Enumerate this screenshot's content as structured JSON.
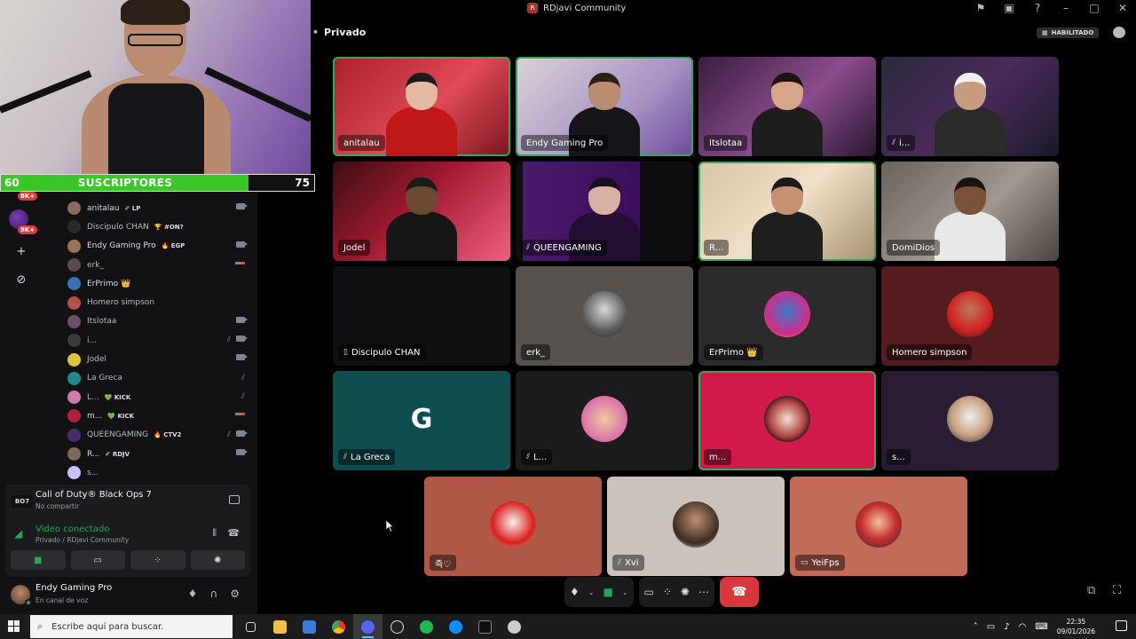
{
  "window": {
    "title": "RDjavi Community",
    "server_icon_text": "R"
  },
  "channel": {
    "name": "Privado",
    "habilitado_label": "HABILITADO"
  },
  "overlay": {
    "sub_goal": {
      "from": "60",
      "label": "SUSCRIPTORES",
      "to": "75",
      "progress": 0.79
    }
  },
  "guild_rail": {
    "badge_top": "8K+",
    "badge_bottom": "9K+"
  },
  "members": [
    {
      "name": "anitalau",
      "tag": "✐ LP",
      "indicator": "camera",
      "avatar": "#8a6a5a",
      "bright": true
    },
    {
      "name": "Discipulo CHAN",
      "tag": "🏆 #ON?",
      "indicator": "",
      "avatar": "#2a2a2a",
      "bright": false
    },
    {
      "name": "Endy Gaming Pro",
      "tag": "🔥 EGP",
      "indicator": "camera",
      "avatar": "#9b7259",
      "bright": true
    },
    {
      "name": "erk_",
      "tag": "",
      "indicator": "live",
      "avatar": "#5a4a4a",
      "bright": false
    },
    {
      "name": "ErPrimo 👑",
      "tag": "",
      "indicator": "",
      "avatar": "#3c6fb5",
      "bright": true
    },
    {
      "name": "Homero simpson",
      "tag": "",
      "indicator": "",
      "avatar": "#b4504a",
      "bright": false
    },
    {
      "name": "Itslotaa",
      "tag": "",
      "indicator": "camera",
      "avatar": "#6d4e66",
      "bright": false
    },
    {
      "name": "i...",
      "tag": "",
      "indicator": "mute-camera",
      "avatar": "#3b3b3b",
      "bright": false
    },
    {
      "name": "Jodel",
      "tag": "",
      "indicator": "camera",
      "avatar": "#e0c33a",
      "bright": false
    },
    {
      "name": "La Greca",
      "tag": "",
      "indicator": "mute",
      "avatar": "#1e8c8c",
      "bright": false
    },
    {
      "name": "L...",
      "tag": "💚 KICK",
      "indicator": "mute",
      "avatar": "#d07aa8",
      "bright": false
    },
    {
      "name": "m...",
      "tag": "💚 KICK",
      "indicator": "live",
      "avatar": "#b0203c",
      "bright": true
    },
    {
      "name": "QUEENGAMING",
      "tag": "🔥 CTV2",
      "indicator": "mute-camera",
      "avatar": "#4a2b6a",
      "bright": false
    },
    {
      "name": "R...",
      "tag": "✐ RDJV",
      "indicator": "camera",
      "avatar": "#7a6a5a",
      "bright": true
    },
    {
      "name": "s...",
      "tag": "",
      "indicator": "",
      "avatar": "#c9c0ff",
      "bright": false
    }
  ],
  "activity": {
    "game_icon": "BO7",
    "game": "Call of Duty® Black Ops 7",
    "sub": "No compartir"
  },
  "voice": {
    "status": "Video conectado",
    "location": "Privado / RDjavi Community"
  },
  "user": {
    "name": "Endy Gaming Pro",
    "status": "En canal de voz"
  },
  "tiles": [
    {
      "label": "anitalau",
      "muted": false,
      "speaking": true,
      "kind": "cam",
      "bg": "linear-gradient(135deg,#a8202a,#e04a55 55%,#7a1520)",
      "skin": "#e3b9a4",
      "hair": "#1b1b1b",
      "shirt": "#c01818"
    },
    {
      "label": "Endy Gaming Pro",
      "muted": false,
      "speaking": true,
      "kind": "cam",
      "bg": "linear-gradient(135deg,#d8d3d6,#a994c4 60%,#6e4a9c)",
      "skin": "#b98c72",
      "hair": "#2b2018",
      "shirt": "#15151a"
    },
    {
      "label": "Itslotaa",
      "muted": false,
      "speaking": false,
      "kind": "cam",
      "bg": "linear-gradient(135deg,#3a1f3e,#8a4c8e 55%,#2a1830)",
      "skin": "#d6a58a",
      "hair": "#1e1410",
      "shirt": "#1d1d1d"
    },
    {
      "label": "i...",
      "muted": true,
      "speaking": false,
      "kind": "cam",
      "bg": "linear-gradient(135deg,#2a2a3a,#4a2a5a 50%,#1a1a2a)",
      "skin": "#c79b80",
      "hair": "#f0f0f0",
      "shirt": "#2a2a2a"
    },
    {
      "label": "Jodel",
      "muted": false,
      "speaking": false,
      "kind": "cam",
      "bg": "linear-gradient(135deg,#3a0d14,#a01a30 45%,#f06080)",
      "skin": "#6b4a34",
      "hair": "#1a1a1a",
      "shirt": "#161616"
    },
    {
      "label": "QUEENGAMING",
      "muted": true,
      "speaking": false,
      "kind": "cam",
      "bg": "linear-gradient(90deg,#0d0d0f 0%,#0d0d0f 4%,#4a1a6a 4%,#3a0e5a 70%,#0d0d0f 70%)",
      "skin": "#d8b0a4",
      "hair": "#1a0f22",
      "shirt": "#240e34"
    },
    {
      "label": "R...",
      "muted": false,
      "speaking": true,
      "kind": "cam",
      "bg": "linear-gradient(135deg,#d8c4a6,#f0e0c8 50%,#a89070)",
      "skin": "#c69273",
      "hair": "#1a1a1a",
      "shirt": "#1f1f1f"
    },
    {
      "label": "DomiDios",
      "muted": false,
      "speaking": false,
      "kind": "cam",
      "bg": "linear-gradient(135deg,#6a625c,#a09890 55%,#4a4440)",
      "skin": "#7a5238",
      "hair": "#1a1410",
      "shirt": "#e8e8e8"
    },
    {
      "label": "Discipulo CHAN",
      "muted": false,
      "speaking": false,
      "phone": true,
      "kind": "dark",
      "bg": "#101012"
    },
    {
      "label": "erk_",
      "muted": false,
      "speaking": false,
      "kind": "pfp",
      "bg": "#57524e",
      "pfp": "radial-gradient(circle at 50% 40%,#d8d8d8,#5a5a5a 60%,#2a2a2a)"
    },
    {
      "label": "ErPrimo 👑",
      "muted": false,
      "speaking": false,
      "kind": "pfp",
      "bg": "#2b2b2d",
      "pfp": "radial-gradient(circle at 50% 45%,#3a78c8,#d42b8a 65%,#f0c020)"
    },
    {
      "label": "Homero simpson",
      "muted": false,
      "speaking": false,
      "kind": "pfp",
      "bg": "#541c1f",
      "pfp": "radial-gradient(circle at 50% 40%,#c07858,#d02020 60%,#202020)"
    },
    {
      "label": "La Greca",
      "muted": true,
      "speaking": false,
      "kind": "pfp",
      "bg": "#0f4d4f",
      "pfp": "radial-gradient(circle,#0f4d4f 30%,#0f4d4f 100%)",
      "pfp_text": "G"
    },
    {
      "label": "L...",
      "muted": true,
      "speaking": false,
      "kind": "pfp",
      "bg": "#1c1c1e",
      "pfp": "radial-gradient(circle at 50% 50%,#f0c8a0,#d96fa8 70%,#3a2a20)"
    },
    {
      "label": "m...",
      "muted": false,
      "speaking": true,
      "kind": "pfp",
      "bg": "#d21a4a",
      "pfp": "radial-gradient(circle at 50% 50%,#f0e0d0,#b04040 55%,#1a1a1a 75%)"
    },
    {
      "label": "s...",
      "muted": false,
      "speaking": false,
      "kind": "pfp",
      "bg": "#2a1d33",
      "pfp": "radial-gradient(circle at 50% 45%,#f0f0f0,#c8a080 55%,#1a2a3a)"
    },
    {
      "label": "즉♡",
      "muted": false,
      "speaking": false,
      "kind": "pfp",
      "bg": "#b05848",
      "pfp": "radial-gradient(circle at 50% 45%,#f8f0e8,#d82020 60%,#c8a880)"
    },
    {
      "label": "Xvi",
      "muted": true,
      "speaking": false,
      "kind": "pfp",
      "bg": "#cac2bc",
      "pfp": "radial-gradient(circle at 50% 40%,#c09070,#3a2a22 65%,#f0f0f0)"
    },
    {
      "label": "YeiFps",
      "muted": false,
      "speaking": false,
      "chip": true,
      "kind": "pfp",
      "bg": "#c26b58",
      "pfp": "radial-gradient(circle at 50% 45%,#f0c0a0,#c83030 50%,#2a2a2a)"
    }
  ],
  "taskbar": {
    "search_placeholder": "Escribe aquí para buscar.",
    "time": "22:35",
    "date": "09/01/2026"
  }
}
